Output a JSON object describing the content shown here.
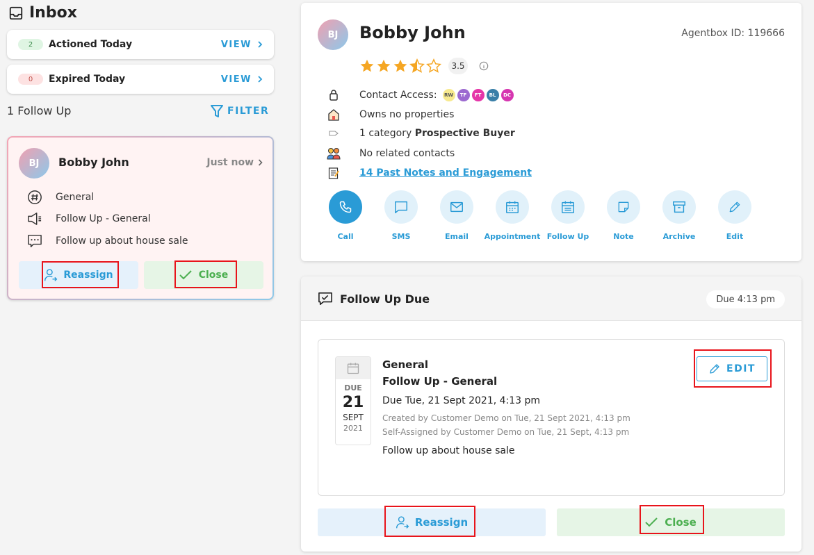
{
  "inbox": {
    "title": "Inbox",
    "actioned": {
      "count": "2",
      "label": "Actioned Today",
      "view": "VIEW"
    },
    "expired": {
      "count": "0",
      "label": "Expired Today",
      "view": "VIEW"
    },
    "follow_count": "1 Follow Up",
    "filter_label": "FILTER",
    "card": {
      "initials": "BJ",
      "name": "Bobby John",
      "time": "Just now",
      "rows": [
        {
          "icon": "hashtag-icon",
          "text": "General"
        },
        {
          "icon": "megaphone-icon",
          "text": "Follow Up - General"
        },
        {
          "icon": "message-icon",
          "text": "Follow up about house sale"
        }
      ],
      "reassign_label": "Reassign",
      "close_label": "Close"
    }
  },
  "contact": {
    "initials": "BJ",
    "name": "Bobby John",
    "agentbox": "Agentbox ID: 119666",
    "rating": "3.5",
    "rating_value": 3.5,
    "rating_max": 5,
    "access_label": "Contact Access:",
    "access_badges": [
      {
        "text": "RW",
        "color": "#f7e98e",
        "fg": "#555"
      },
      {
        "text": "TF",
        "color": "#9c6ad0",
        "fg": "#fff"
      },
      {
        "text": "FT",
        "color": "#e535a8",
        "fg": "#fff"
      },
      {
        "text": "BL",
        "color": "#3a7fa8",
        "fg": "#fff"
      },
      {
        "text": "DC",
        "color": "#d636b0",
        "fg": "#fff"
      }
    ],
    "properties": "Owns no properties",
    "category_prefix": "1 category ",
    "category_name": "Prospective Buyer",
    "related": "No related contacts",
    "notes_link": "14 Past Notes and Engagement",
    "actions": [
      "Call",
      "SMS",
      "Email",
      "Appointment",
      "Follow Up",
      "Note",
      "Archive",
      "Edit"
    ]
  },
  "due": {
    "title": "Follow Up Due",
    "pill": "Due 4:13 pm",
    "cal": {
      "label": "DUE",
      "day": "21",
      "month": "SEPT",
      "year": "2021"
    },
    "category": "General",
    "type": "Follow Up - General",
    "due_line": "Due Tue, 21 Sept 2021, 4:13 pm",
    "created": "Created by Customer Demo on Tue, 21 Sept 2021, 4:13 pm",
    "assigned": "Self-Assigned by Customer Demo on Tue, 21 Sept, 4:13 pm",
    "note": "Follow up about house sale",
    "edit_label": "EDIT",
    "reassign_label": "Reassign",
    "close_label": "Close"
  },
  "colors": {
    "accent": "#2a9bd6",
    "success": "#4caf50",
    "highlight": "#e8141b",
    "star": "#f5a623"
  }
}
